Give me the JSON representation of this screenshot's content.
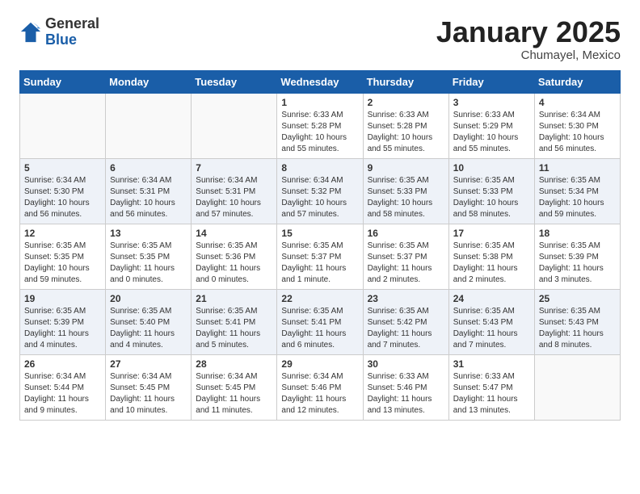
{
  "logo": {
    "general": "General",
    "blue": "Blue"
  },
  "header": {
    "month": "January 2025",
    "location": "Chumayel, Mexico"
  },
  "weekdays": [
    "Sunday",
    "Monday",
    "Tuesday",
    "Wednesday",
    "Thursday",
    "Friday",
    "Saturday"
  ],
  "weeks": [
    [
      {
        "day": "",
        "info": ""
      },
      {
        "day": "",
        "info": ""
      },
      {
        "day": "",
        "info": ""
      },
      {
        "day": "1",
        "info": "Sunrise: 6:33 AM\nSunset: 5:28 PM\nDaylight: 10 hours and 55 minutes."
      },
      {
        "day": "2",
        "info": "Sunrise: 6:33 AM\nSunset: 5:28 PM\nDaylight: 10 hours and 55 minutes."
      },
      {
        "day": "3",
        "info": "Sunrise: 6:33 AM\nSunset: 5:29 PM\nDaylight: 10 hours and 55 minutes."
      },
      {
        "day": "4",
        "info": "Sunrise: 6:34 AM\nSunset: 5:30 PM\nDaylight: 10 hours and 56 minutes."
      }
    ],
    [
      {
        "day": "5",
        "info": "Sunrise: 6:34 AM\nSunset: 5:30 PM\nDaylight: 10 hours and 56 minutes."
      },
      {
        "day": "6",
        "info": "Sunrise: 6:34 AM\nSunset: 5:31 PM\nDaylight: 10 hours and 56 minutes."
      },
      {
        "day": "7",
        "info": "Sunrise: 6:34 AM\nSunset: 5:31 PM\nDaylight: 10 hours and 57 minutes."
      },
      {
        "day": "8",
        "info": "Sunrise: 6:34 AM\nSunset: 5:32 PM\nDaylight: 10 hours and 57 minutes."
      },
      {
        "day": "9",
        "info": "Sunrise: 6:35 AM\nSunset: 5:33 PM\nDaylight: 10 hours and 58 minutes."
      },
      {
        "day": "10",
        "info": "Sunrise: 6:35 AM\nSunset: 5:33 PM\nDaylight: 10 hours and 58 minutes."
      },
      {
        "day": "11",
        "info": "Sunrise: 6:35 AM\nSunset: 5:34 PM\nDaylight: 10 hours and 59 minutes."
      }
    ],
    [
      {
        "day": "12",
        "info": "Sunrise: 6:35 AM\nSunset: 5:35 PM\nDaylight: 10 hours and 59 minutes."
      },
      {
        "day": "13",
        "info": "Sunrise: 6:35 AM\nSunset: 5:35 PM\nDaylight: 11 hours and 0 minutes."
      },
      {
        "day": "14",
        "info": "Sunrise: 6:35 AM\nSunset: 5:36 PM\nDaylight: 11 hours and 0 minutes."
      },
      {
        "day": "15",
        "info": "Sunrise: 6:35 AM\nSunset: 5:37 PM\nDaylight: 11 hours and 1 minute."
      },
      {
        "day": "16",
        "info": "Sunrise: 6:35 AM\nSunset: 5:37 PM\nDaylight: 11 hours and 2 minutes."
      },
      {
        "day": "17",
        "info": "Sunrise: 6:35 AM\nSunset: 5:38 PM\nDaylight: 11 hours and 2 minutes."
      },
      {
        "day": "18",
        "info": "Sunrise: 6:35 AM\nSunset: 5:39 PM\nDaylight: 11 hours and 3 minutes."
      }
    ],
    [
      {
        "day": "19",
        "info": "Sunrise: 6:35 AM\nSunset: 5:39 PM\nDaylight: 11 hours and 4 minutes."
      },
      {
        "day": "20",
        "info": "Sunrise: 6:35 AM\nSunset: 5:40 PM\nDaylight: 11 hours and 4 minutes."
      },
      {
        "day": "21",
        "info": "Sunrise: 6:35 AM\nSunset: 5:41 PM\nDaylight: 11 hours and 5 minutes."
      },
      {
        "day": "22",
        "info": "Sunrise: 6:35 AM\nSunset: 5:41 PM\nDaylight: 11 hours and 6 minutes."
      },
      {
        "day": "23",
        "info": "Sunrise: 6:35 AM\nSunset: 5:42 PM\nDaylight: 11 hours and 7 minutes."
      },
      {
        "day": "24",
        "info": "Sunrise: 6:35 AM\nSunset: 5:43 PM\nDaylight: 11 hours and 7 minutes."
      },
      {
        "day": "25",
        "info": "Sunrise: 6:35 AM\nSunset: 5:43 PM\nDaylight: 11 hours and 8 minutes."
      }
    ],
    [
      {
        "day": "26",
        "info": "Sunrise: 6:34 AM\nSunset: 5:44 PM\nDaylight: 11 hours and 9 minutes."
      },
      {
        "day": "27",
        "info": "Sunrise: 6:34 AM\nSunset: 5:45 PM\nDaylight: 11 hours and 10 minutes."
      },
      {
        "day": "28",
        "info": "Sunrise: 6:34 AM\nSunset: 5:45 PM\nDaylight: 11 hours and 11 minutes."
      },
      {
        "day": "29",
        "info": "Sunrise: 6:34 AM\nSunset: 5:46 PM\nDaylight: 11 hours and 12 minutes."
      },
      {
        "day": "30",
        "info": "Sunrise: 6:33 AM\nSunset: 5:46 PM\nDaylight: 11 hours and 13 minutes."
      },
      {
        "day": "31",
        "info": "Sunrise: 6:33 AM\nSunset: 5:47 PM\nDaylight: 11 hours and 13 minutes."
      },
      {
        "day": "",
        "info": ""
      }
    ]
  ]
}
